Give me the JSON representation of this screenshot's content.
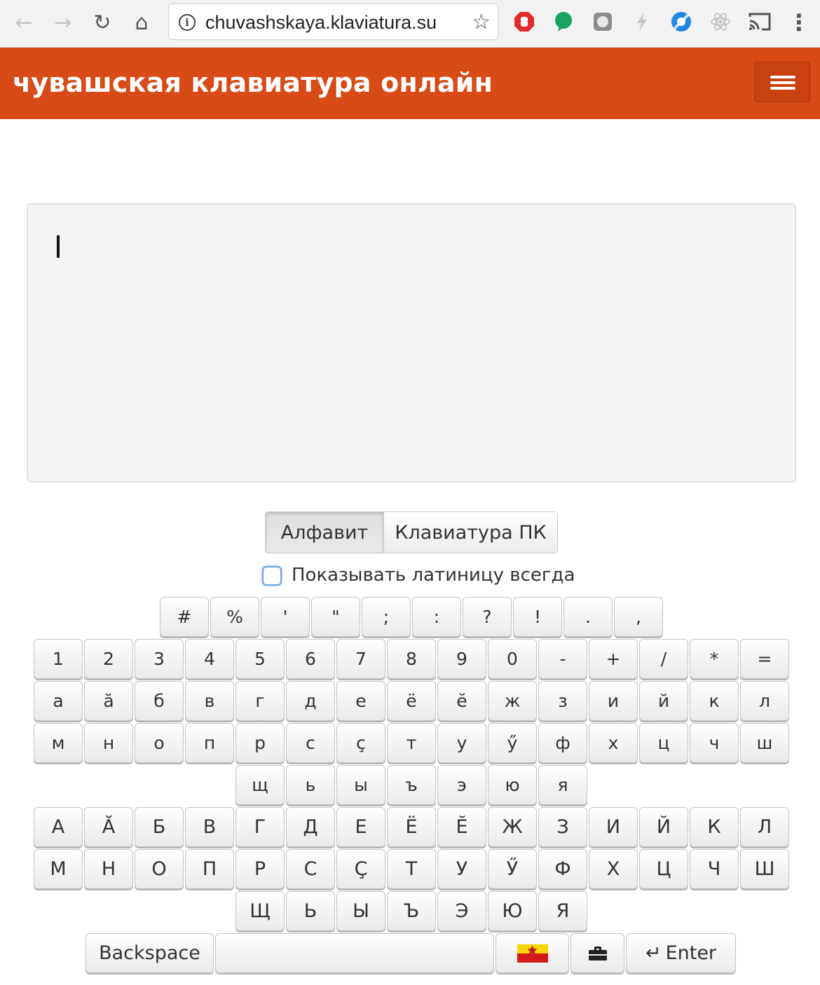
{
  "browser": {
    "url": "chuvashskaya.klaviatura.su",
    "back_icon": "←",
    "forward_icon": "→",
    "reload_icon": "↻",
    "home_icon": "⌂",
    "star_icon": "☆",
    "menu_icon": "⋮"
  },
  "header": {
    "title": "чувашская клавиатура онлайн"
  },
  "modes": {
    "alphabet": "Алфавит",
    "pc_keyboard": "Клавиатура ПК"
  },
  "latin_checkbox": {
    "label": "Показывать латиницу всегда",
    "checked": false
  },
  "keyboard": {
    "symbols": [
      "#",
      "%",
      "'",
      "\"",
      ";",
      ":",
      "?",
      "!",
      ".",
      ","
    ],
    "digits": [
      "1",
      "2",
      "3",
      "4",
      "5",
      "6",
      "7",
      "8",
      "9",
      "0",
      "-",
      "+",
      "/",
      "*",
      "="
    ],
    "lower_1": [
      "а",
      "ӑ",
      "б",
      "в",
      "г",
      "д",
      "е",
      "ё",
      "ӗ",
      "ж",
      "з",
      "и",
      "й",
      "к",
      "л"
    ],
    "lower_2": [
      "м",
      "н",
      "о",
      "п",
      "р",
      "с",
      "ç",
      "т",
      "у",
      "ӳ",
      "ф",
      "х",
      "ц",
      "ч",
      "ш"
    ],
    "lower_3": [
      "щ",
      "ь",
      "ы",
      "ъ",
      "э",
      "ю",
      "я"
    ],
    "upper_1": [
      "А",
      "Ӑ",
      "Б",
      "В",
      "Г",
      "Д",
      "Е",
      "Ё",
      "Ӗ",
      "Ж",
      "З",
      "И",
      "Й",
      "К",
      "Л"
    ],
    "upper_2": [
      "М",
      "Н",
      "О",
      "П",
      "Р",
      "С",
      "Ç",
      "Т",
      "У",
      "Ӳ",
      "Ф",
      "Х",
      "Ц",
      "Ч",
      "Ш"
    ],
    "upper_3": [
      "Щ",
      "Ь",
      "Ы",
      "Ъ",
      "Э",
      "Ю",
      "Я"
    ],
    "backspace": "Backspace",
    "enter": "Enter",
    "enter_icon": "↵"
  },
  "colors": {
    "header_bg": "#d84a16",
    "page_bg": "#ffffff"
  }
}
